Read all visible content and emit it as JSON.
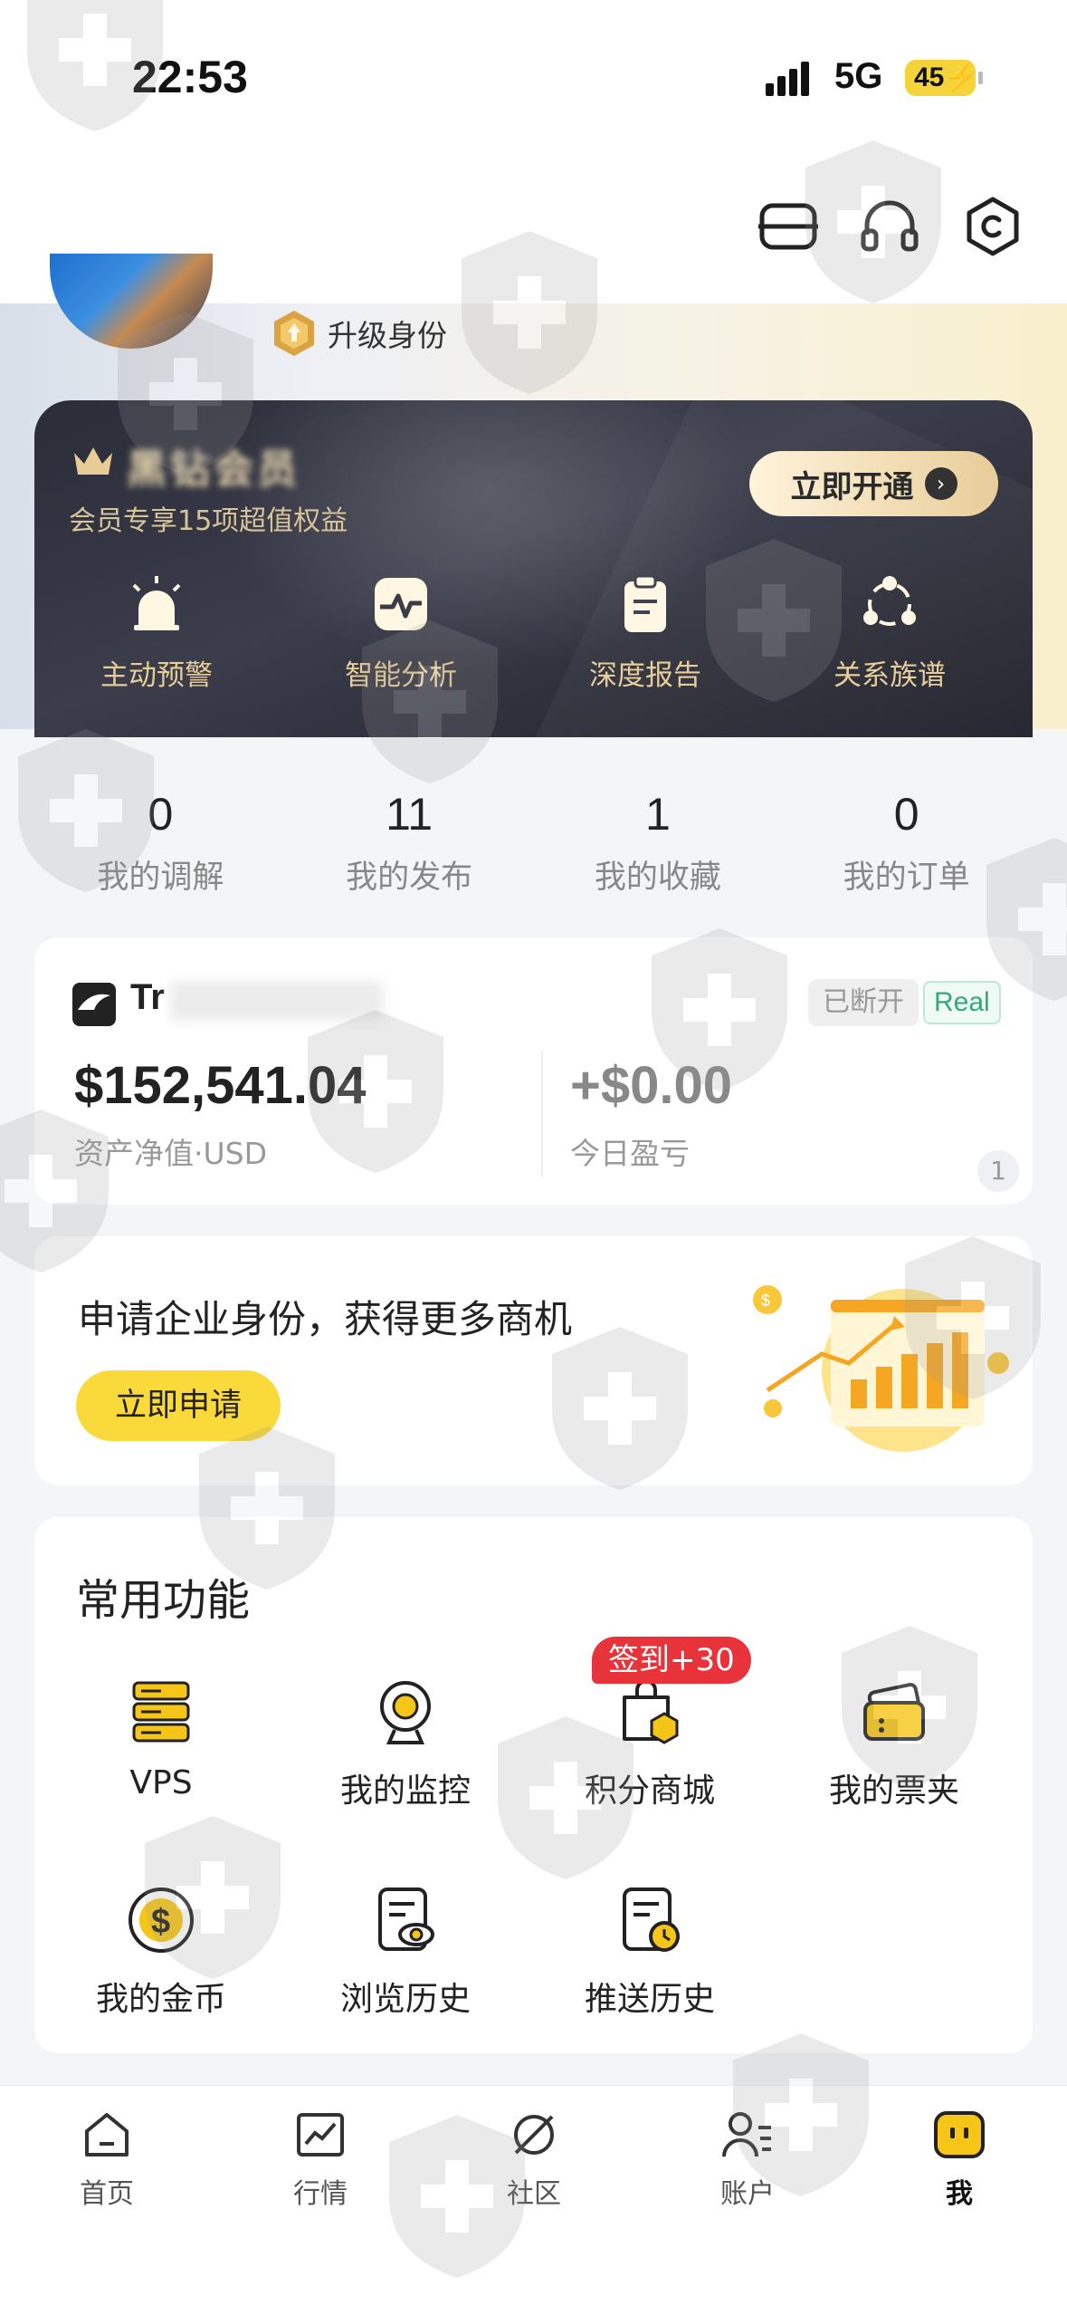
{
  "status_bar": {
    "time": "22:53",
    "network": "5G",
    "battery": "45"
  },
  "top_actions": {
    "icons": [
      "scan-icon",
      "headset-icon",
      "settings-icon"
    ]
  },
  "profile": {
    "upgrade_label": "升级身份"
  },
  "vip_card": {
    "title": "黑钻会员",
    "subtitle": "会员专享15项超值权益",
    "open_button": "立即开通",
    "features": [
      {
        "label": "主动预警",
        "icon": "alarm-light-icon"
      },
      {
        "label": "智能分析",
        "icon": "pulse-chart-icon"
      },
      {
        "label": "深度报告",
        "icon": "clipboard-report-icon"
      },
      {
        "label": "关系族谱",
        "icon": "relation-graph-icon"
      }
    ]
  },
  "stats": [
    {
      "value": "0",
      "label": "我的调解"
    },
    {
      "value": "11",
      "label": "我的发布"
    },
    {
      "value": "1",
      "label": "我的收藏"
    },
    {
      "value": "0",
      "label": "我的订单"
    }
  ],
  "account": {
    "broker_name": "Tr",
    "status_tag": "已断开",
    "type_tag": "Real",
    "equity": "$152,541.04",
    "equity_label": "资产净值·USD",
    "pnl": "+$0.00",
    "pnl_label": "今日盈亏",
    "page": "1"
  },
  "enterprise": {
    "title": "申请企业身份，获得更多商机",
    "button": "立即申请"
  },
  "functions": {
    "title": "常用功能",
    "checkin_badge": "签到+30",
    "items": [
      {
        "label": "VPS",
        "icon": "server-icon"
      },
      {
        "label": "我的监控",
        "icon": "camera-icon"
      },
      {
        "label": "积分商城",
        "icon": "shopping-bag-icon"
      },
      {
        "label": "我的票夹",
        "icon": "ticket-wallet-icon"
      },
      {
        "label": "我的金币",
        "icon": "coin-icon"
      },
      {
        "label": "浏览历史",
        "icon": "browse-history-icon"
      },
      {
        "label": "推送历史",
        "icon": "push-history-icon"
      }
    ]
  },
  "bottom_nav": [
    {
      "label": "首页",
      "icon": "home-icon"
    },
    {
      "label": "行情",
      "icon": "market-chart-icon"
    },
    {
      "label": "社区",
      "icon": "community-icon"
    },
    {
      "label": "账户",
      "icon": "account-icon"
    },
    {
      "label": "我",
      "icon": "me-icon",
      "active": true
    }
  ],
  "colors": {
    "accent_yellow": "#FAD93A",
    "vip_gold": "#E8CC96",
    "badge_red": "#E8333A",
    "real_green": "#34A87A"
  }
}
